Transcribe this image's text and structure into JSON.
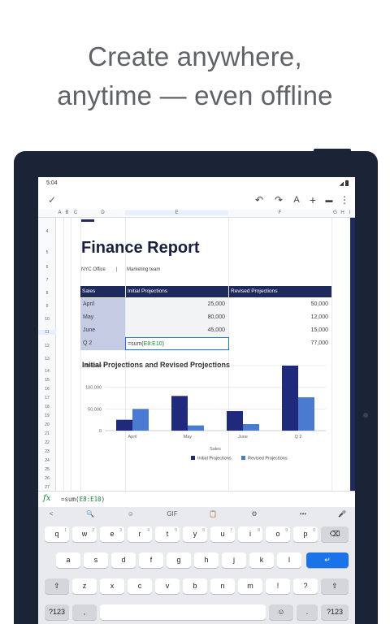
{
  "headline": {
    "line1": "Create anywhere,",
    "line2": "anytime — even offline"
  },
  "statusbar": {
    "time": "5:04"
  },
  "toolbar": {
    "done_icon": "✓",
    "undo_icon": "↶",
    "redo_icon": "↷",
    "text_format_icon": "A",
    "add_icon": "+",
    "comment_icon": "▬",
    "more_icon": "⋮"
  },
  "columns": [
    "A",
    "B",
    "C",
    "D",
    "E",
    "F",
    "G",
    "H",
    "I"
  ],
  "rows": [
    "4",
    "5",
    "6",
    "7",
    "8",
    "9",
    "10",
    "11",
    "12",
    "13",
    "14",
    "15",
    "16",
    "17",
    "18",
    "19",
    "20",
    "21",
    "22",
    "23",
    "24",
    "25",
    "26",
    "27"
  ],
  "report": {
    "title": "Finance Report",
    "office": "NYC Office",
    "separator": "|",
    "team": "Marketing team",
    "headers": [
      "Sales",
      "Initial Projections",
      "Revised Projections"
    ],
    "rows": [
      {
        "label": "April",
        "initial": "25,000",
        "revised": "50,000"
      },
      {
        "label": "May",
        "initial": "80,000",
        "revised": "12,000"
      },
      {
        "label": "June",
        "initial": "45,000",
        "revised": "15,000"
      },
      {
        "label": "Q 2",
        "initial": "=sum(E8:E10)",
        "revised": "77,000"
      }
    ],
    "formula_prefix": "=sum(",
    "formula_range": "E8:E10",
    "formula_suffix": ")"
  },
  "chart_data": {
    "type": "bar",
    "title": "Initial Projections and Revised Projections",
    "categories": [
      "April",
      "May",
      "June",
      "Q 2"
    ],
    "series": [
      {
        "name": "Initial Projections",
        "values": [
          25000,
          80000,
          45000,
          150000
        ],
        "color": "#1f2a7c"
      },
      {
        "name": "Revised Projections",
        "values": [
          50000,
          12000,
          15000,
          77000
        ],
        "color": "#4a7bd0"
      }
    ],
    "xlabel": "Sales",
    "ylabel": "",
    "ylim": [
      0,
      150000
    ],
    "yticks": [
      "0",
      "50,000",
      "100,000",
      "150,000"
    ],
    "legend": "bottom"
  },
  "formulabar": {
    "fx": "fx",
    "prefix": "=sum(",
    "range": "E8:E10",
    "suffix": ")"
  },
  "keyboard": {
    "suggest_icons": [
      "<",
      "🔍",
      "☺",
      "GIF",
      "📋",
      "⚙",
      "•••",
      "🎤"
    ],
    "row1": [
      "q",
      "w",
      "e",
      "r",
      "t",
      "y",
      "u",
      "i",
      "o",
      "p"
    ],
    "row1_alt": [
      "1",
      "2",
      "3",
      "4",
      "5",
      "6",
      "7",
      "8",
      "9",
      "0"
    ],
    "row2": [
      "a",
      "s",
      "d",
      "f",
      "g",
      "h",
      "j",
      "k",
      "l"
    ],
    "row3": [
      "z",
      "x",
      "c",
      "v",
      "b",
      "n",
      "m",
      "!",
      "?"
    ],
    "backspace": "⌫",
    "enter": "↵",
    "shift": "⇧",
    "sym": "?123",
    "comma": ",",
    "period": ".",
    "emoji": "☺"
  }
}
